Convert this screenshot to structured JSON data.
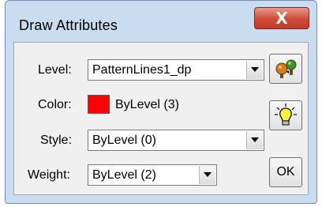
{
  "window": {
    "title": "Draw Attributes",
    "close_label": "X"
  },
  "fields": {
    "level": {
      "label": "Level:",
      "value": "PatternLines1_dp"
    },
    "color": {
      "label": "Color:",
      "swatch_color": "#ff0000",
      "value": "ByLevel (3)"
    },
    "style": {
      "label": "Style:",
      "value": "ByLevel (0)"
    },
    "weight": {
      "label": "Weight:",
      "value": "ByLevel (2)"
    }
  },
  "buttons": {
    "ok_label": "OK",
    "match_icon": "paint-tree-icon",
    "highlight_icon": "lightbulb-icon"
  },
  "colors": {
    "frame": "#c9dcf0",
    "close": "#c94a36"
  }
}
